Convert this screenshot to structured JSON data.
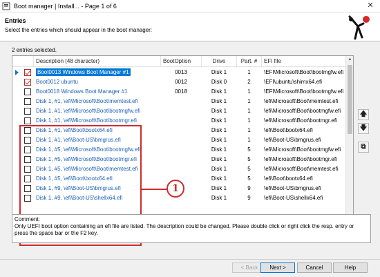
{
  "window": {
    "title": "Boot manager | Install...  -  Page 1 of 6",
    "close_glyph": "✕"
  },
  "header": {
    "title": "Entries",
    "subtitle": "Select the entries which should appear in the boot manager:"
  },
  "status": {
    "selected_count": "2 entries selected."
  },
  "table": {
    "columns": [
      "Description (48 character)",
      "BootOption",
      "Drive",
      "Part. #",
      "EFI file"
    ],
    "rows": [
      {
        "desc": "Boot0013 Windows Boot Manager #1",
        "boot": "0013",
        "drive": "Disk 1",
        "part": "1",
        "efi": "\\EFI\\Microsoft\\Boot\\bootmgfw.efi",
        "checked": true,
        "selected": true
      },
      {
        "desc": "Boot0012 ubuntu",
        "boot": "0012",
        "drive": "Disk 0",
        "part": "2",
        "efi": "\\EFI\\ubuntu\\shimx64.efi",
        "checked": true,
        "selected": false
      },
      {
        "desc": "Boot0018 Windows Boot Manager #1",
        "boot": "0018",
        "drive": "Disk 1",
        "part": "1",
        "efi": "\\EFI\\Microsoft\\Boot\\bootmgfw.efi",
        "checked": false,
        "selected": false
      },
      {
        "desc": "Disk 1, #1, \\efi\\Microsoft\\Boot\\memtest.efi",
        "boot": "",
        "drive": "Disk 1",
        "part": "1",
        "efi": "\\efi\\Microsoft\\Boot\\memtest.efi",
        "checked": false,
        "selected": false
      },
      {
        "desc": "Disk 1, #1, \\efi\\Microsoft\\Boot\\bootmgfw.efi",
        "boot": "",
        "drive": "Disk 1",
        "part": "1",
        "efi": "\\efi\\Microsoft\\Boot\\bootmgfw.efi",
        "checked": false,
        "selected": false
      },
      {
        "desc": "Disk 1, #1, \\efi\\Microsoft\\Boot\\bootmgr.efi",
        "boot": "",
        "drive": "Disk 1",
        "part": "1",
        "efi": "\\efi\\Microsoft\\Boot\\bootmgr.efi",
        "checked": false,
        "selected": false
      },
      {
        "desc": "Disk 1, #1, \\efi\\Boot\\bootx64.efi",
        "boot": "",
        "drive": "Disk 1",
        "part": "1",
        "efi": "\\efi\\Boot\\bootx64.efi",
        "checked": false,
        "selected": false
      },
      {
        "desc": "Disk 1, #1, \\efi\\Boot-US\\bmgrus.efi",
        "boot": "",
        "drive": "Disk 1",
        "part": "1",
        "efi": "\\efi\\Boot-US\\bmgrus.efi",
        "checked": false,
        "selected": false
      },
      {
        "desc": "Disk 1, #5, \\efi\\Microsoft\\Boot\\bootmgfw.efi",
        "boot": "",
        "drive": "Disk 1",
        "part": "5",
        "efi": "\\efi\\Microsoft\\Boot\\bootmgfw.efi",
        "checked": false,
        "selected": false
      },
      {
        "desc": "Disk 1, #5, \\efi\\Microsoft\\Boot\\bootmgr.efi",
        "boot": "",
        "drive": "Disk 1",
        "part": "5",
        "efi": "\\efi\\Microsoft\\Boot\\bootmgr.efi",
        "checked": false,
        "selected": false
      },
      {
        "desc": "Disk 1, #5, \\efi\\Microsoft\\Boot\\memtest.efi",
        "boot": "",
        "drive": "Disk 1",
        "part": "5",
        "efi": "\\efi\\Microsoft\\Boot\\memtest.efi",
        "checked": false,
        "selected": false
      },
      {
        "desc": "Disk 1, #5, \\efi\\Boot\\bootx64.efi",
        "boot": "",
        "drive": "Disk 1",
        "part": "5",
        "efi": "\\efi\\Boot\\bootx64.efi",
        "checked": false,
        "selected": false
      },
      {
        "desc": "Disk 1, #9, \\efi\\Boot-US\\bmgrus.efi",
        "boot": "",
        "drive": "Disk 1",
        "part": "9",
        "efi": "\\efi\\Boot-US\\bmgrus.efi",
        "checked": false,
        "selected": false
      },
      {
        "desc": "Disk 1, #9, \\efi\\Boot-US\\shellx64.efi",
        "boot": "",
        "drive": "Disk 1",
        "part": "9",
        "efi": "\\efi\\Boot-US\\shellx64.efi",
        "checked": false,
        "selected": false
      }
    ]
  },
  "callout": {
    "number": "1",
    "color": "#d02c2c"
  },
  "side_buttons": {
    "move_up": "🡅",
    "move_down": "🡇",
    "copy": "⧉"
  },
  "comment": {
    "label": "Comment:",
    "text": "Only UEFI boot option containing an efi file are listed. The description could be changed. Please double click or right click the resp. entry or press the space bar or the F2 key."
  },
  "buttons": {
    "back": "< Back",
    "next": "Next >",
    "cancel": "Cancel",
    "help": "Help"
  },
  "colors": {
    "accent": "#0078d7",
    "link_text": "#1a5fb4",
    "highlight_box": "#d02c2c"
  }
}
